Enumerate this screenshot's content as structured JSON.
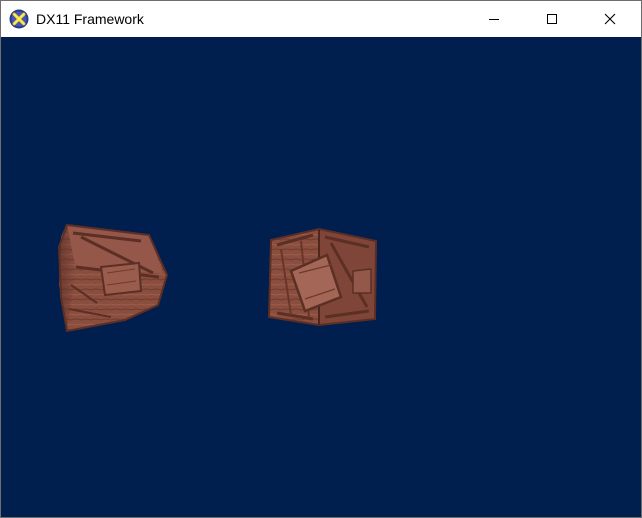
{
  "window": {
    "title": "DX11 Framework",
    "icon": "directx-x-icon",
    "clear_color": "#001e4e"
  },
  "caption_buttons": {
    "minimize": "minimize-icon",
    "maximize": "maximize-icon",
    "close": "close-icon"
  },
  "scene": {
    "objects": [
      {
        "name": "crate-left",
        "texture": "wooden-crate"
      },
      {
        "name": "crate-right",
        "texture": "wooden-crate"
      }
    ],
    "crate_color": "#8a4e3f"
  }
}
